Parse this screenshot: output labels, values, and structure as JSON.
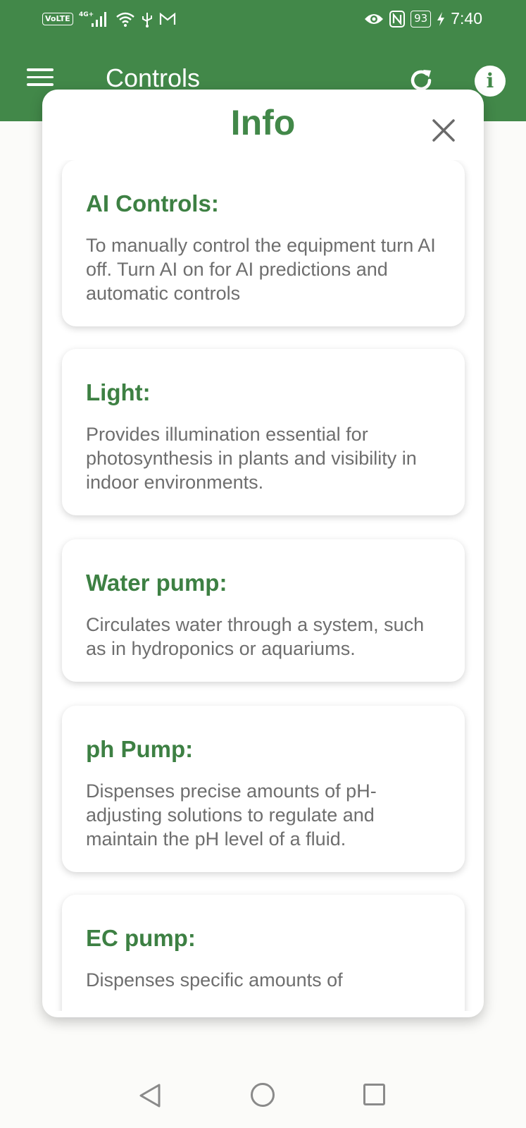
{
  "status_bar": {
    "volte": "VoLTE",
    "network": "4G+",
    "battery": "93",
    "time": "7:40"
  },
  "appbar": {
    "title": "Controls",
    "background": "#428849"
  },
  "modal": {
    "title": "Info",
    "cards": [
      {
        "title": "AI Controls:",
        "text": "To manually control the equipment turn AI off. Turn AI on for AI predictions and automatic controls"
      },
      {
        "title": "Light:",
        "text": "Provides illumination essential for photosynthesis in plants and visibility in indoor environments."
      },
      {
        "title": "Water pump:",
        "text": "Circulates water through a system, such as in hydroponics or aquariums."
      },
      {
        "title": "ph Pump:",
        "text": "Dispenses precise amounts of pH-adjusting solutions to regulate and maintain the pH level of a fluid."
      },
      {
        "title": "EC pump:",
        "text": "Dispenses specific amounts of"
      }
    ]
  },
  "colors": {
    "accent": "#428849",
    "card_title": "#3d8043",
    "body_text": "#6e6e6e"
  },
  "icons": {
    "menu": "menu-icon",
    "refresh": "refresh-icon",
    "info": "info-icon",
    "close": "close-icon",
    "nav_back": "back-icon",
    "nav_home": "home-icon",
    "nav_recent": "recent-apps-icon"
  }
}
